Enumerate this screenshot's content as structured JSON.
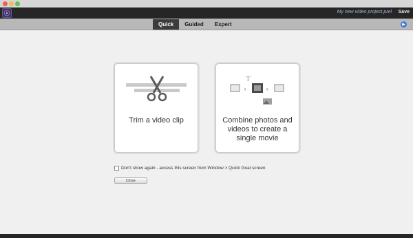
{
  "app": {
    "project_name": "My new video project.prel",
    "save_label": "Save"
  },
  "modes": {
    "tabs": [
      "Quick",
      "Guided",
      "Expert"
    ],
    "active": "Quick"
  },
  "cards": {
    "trim_label": "Trim a video clip",
    "combine_lines": [
      "Combine photos and",
      "videos to create a",
      "single movie"
    ]
  },
  "options": {
    "dont_show_label": "Don't show again - access this screen from Window > Quick Goal screen",
    "checked": false
  },
  "actions": {
    "close_label": "Close"
  },
  "colors": {
    "accent_active_tab": "#3c3c3c",
    "help_icon": "#3d7bd6",
    "app_bar": "#262626"
  }
}
